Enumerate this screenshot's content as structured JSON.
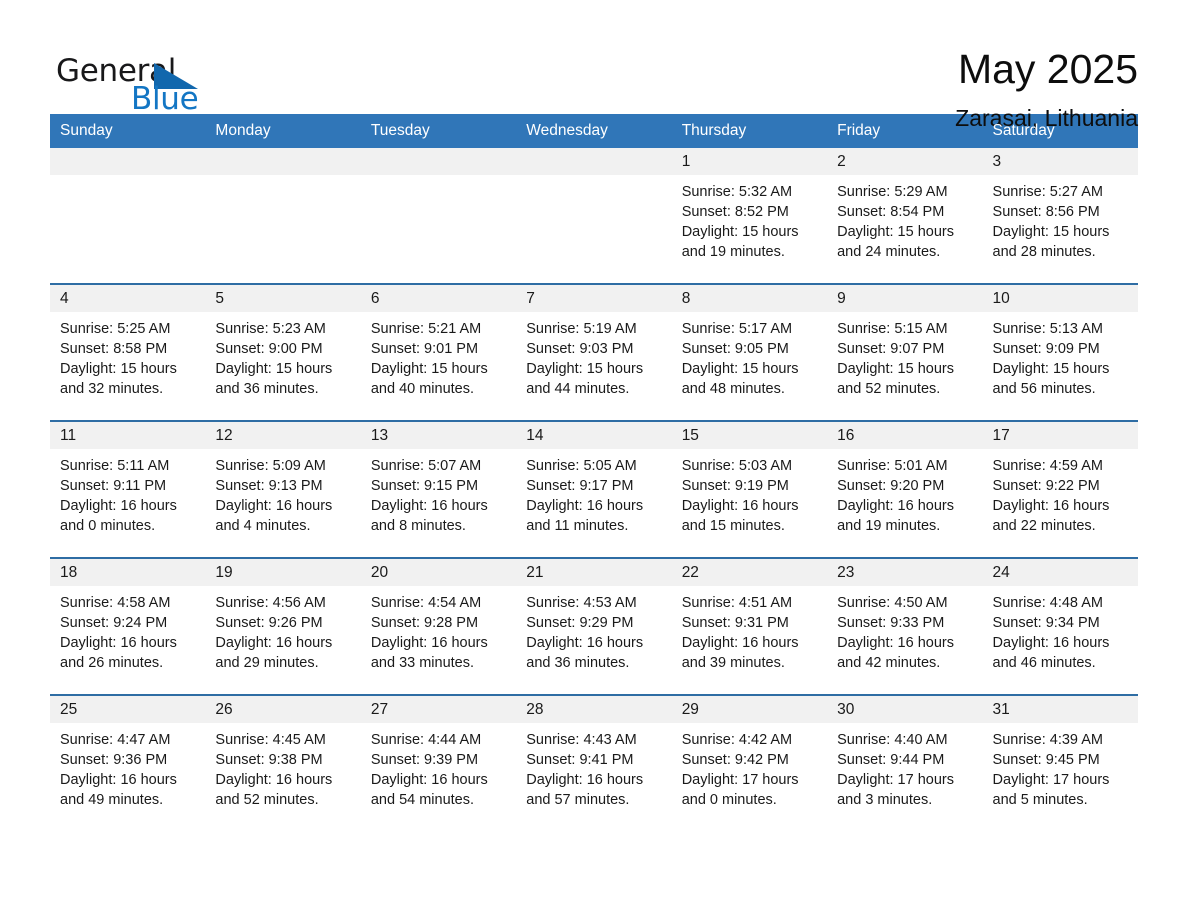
{
  "brand": {
    "word1": "General",
    "word2": "Blue",
    "triangle_color": "#1167ad",
    "blue_color": "#1376c4"
  },
  "header": {
    "title": "May 2025",
    "subtitle": "Zarasai, Lithuania"
  },
  "theme": {
    "header_blue": "#3076b8",
    "row_rule_blue": "#2e6da4",
    "daynum_band": "#f1f1f1"
  },
  "weekdays": [
    "Sunday",
    "Monday",
    "Tuesday",
    "Wednesday",
    "Thursday",
    "Friday",
    "Saturday"
  ],
  "weeks": [
    [
      {
        "blank": true
      },
      {
        "blank": true
      },
      {
        "blank": true
      },
      {
        "blank": true
      },
      {
        "day": "1",
        "sunrise": "Sunrise: 5:32 AM",
        "sunset": "Sunset: 8:52 PM",
        "daylight1": "Daylight: 15 hours",
        "daylight2": "and 19 minutes."
      },
      {
        "day": "2",
        "sunrise": "Sunrise: 5:29 AM",
        "sunset": "Sunset: 8:54 PM",
        "daylight1": "Daylight: 15 hours",
        "daylight2": "and 24 minutes."
      },
      {
        "day": "3",
        "sunrise": "Sunrise: 5:27 AM",
        "sunset": "Sunset: 8:56 PM",
        "daylight1": "Daylight: 15 hours",
        "daylight2": "and 28 minutes."
      }
    ],
    [
      {
        "day": "4",
        "sunrise": "Sunrise: 5:25 AM",
        "sunset": "Sunset: 8:58 PM",
        "daylight1": "Daylight: 15 hours",
        "daylight2": "and 32 minutes."
      },
      {
        "day": "5",
        "sunrise": "Sunrise: 5:23 AM",
        "sunset": "Sunset: 9:00 PM",
        "daylight1": "Daylight: 15 hours",
        "daylight2": "and 36 minutes."
      },
      {
        "day": "6",
        "sunrise": "Sunrise: 5:21 AM",
        "sunset": "Sunset: 9:01 PM",
        "daylight1": "Daylight: 15 hours",
        "daylight2": "and 40 minutes."
      },
      {
        "day": "7",
        "sunrise": "Sunrise: 5:19 AM",
        "sunset": "Sunset: 9:03 PM",
        "daylight1": "Daylight: 15 hours",
        "daylight2": "and 44 minutes."
      },
      {
        "day": "8",
        "sunrise": "Sunrise: 5:17 AM",
        "sunset": "Sunset: 9:05 PM",
        "daylight1": "Daylight: 15 hours",
        "daylight2": "and 48 minutes."
      },
      {
        "day": "9",
        "sunrise": "Sunrise: 5:15 AM",
        "sunset": "Sunset: 9:07 PM",
        "daylight1": "Daylight: 15 hours",
        "daylight2": "and 52 minutes."
      },
      {
        "day": "10",
        "sunrise": "Sunrise: 5:13 AM",
        "sunset": "Sunset: 9:09 PM",
        "daylight1": "Daylight: 15 hours",
        "daylight2": "and 56 minutes."
      }
    ],
    [
      {
        "day": "11",
        "sunrise": "Sunrise: 5:11 AM",
        "sunset": "Sunset: 9:11 PM",
        "daylight1": "Daylight: 16 hours",
        "daylight2": "and 0 minutes."
      },
      {
        "day": "12",
        "sunrise": "Sunrise: 5:09 AM",
        "sunset": "Sunset: 9:13 PM",
        "daylight1": "Daylight: 16 hours",
        "daylight2": "and 4 minutes."
      },
      {
        "day": "13",
        "sunrise": "Sunrise: 5:07 AM",
        "sunset": "Sunset: 9:15 PM",
        "daylight1": "Daylight: 16 hours",
        "daylight2": "and 8 minutes."
      },
      {
        "day": "14",
        "sunrise": "Sunrise: 5:05 AM",
        "sunset": "Sunset: 9:17 PM",
        "daylight1": "Daylight: 16 hours",
        "daylight2": "and 11 minutes."
      },
      {
        "day": "15",
        "sunrise": "Sunrise: 5:03 AM",
        "sunset": "Sunset: 9:19 PM",
        "daylight1": "Daylight: 16 hours",
        "daylight2": "and 15 minutes."
      },
      {
        "day": "16",
        "sunrise": "Sunrise: 5:01 AM",
        "sunset": "Sunset: 9:20 PM",
        "daylight1": "Daylight: 16 hours",
        "daylight2": "and 19 minutes."
      },
      {
        "day": "17",
        "sunrise": "Sunrise: 4:59 AM",
        "sunset": "Sunset: 9:22 PM",
        "daylight1": "Daylight: 16 hours",
        "daylight2": "and 22 minutes."
      }
    ],
    [
      {
        "day": "18",
        "sunrise": "Sunrise: 4:58 AM",
        "sunset": "Sunset: 9:24 PM",
        "daylight1": "Daylight: 16 hours",
        "daylight2": "and 26 minutes."
      },
      {
        "day": "19",
        "sunrise": "Sunrise: 4:56 AM",
        "sunset": "Sunset: 9:26 PM",
        "daylight1": "Daylight: 16 hours",
        "daylight2": "and 29 minutes."
      },
      {
        "day": "20",
        "sunrise": "Sunrise: 4:54 AM",
        "sunset": "Sunset: 9:28 PM",
        "daylight1": "Daylight: 16 hours",
        "daylight2": "and 33 minutes."
      },
      {
        "day": "21",
        "sunrise": "Sunrise: 4:53 AM",
        "sunset": "Sunset: 9:29 PM",
        "daylight1": "Daylight: 16 hours",
        "daylight2": "and 36 minutes."
      },
      {
        "day": "22",
        "sunrise": "Sunrise: 4:51 AM",
        "sunset": "Sunset: 9:31 PM",
        "daylight1": "Daylight: 16 hours",
        "daylight2": "and 39 minutes."
      },
      {
        "day": "23",
        "sunrise": "Sunrise: 4:50 AM",
        "sunset": "Sunset: 9:33 PM",
        "daylight1": "Daylight: 16 hours",
        "daylight2": "and 42 minutes."
      },
      {
        "day": "24",
        "sunrise": "Sunrise: 4:48 AM",
        "sunset": "Sunset: 9:34 PM",
        "daylight1": "Daylight: 16 hours",
        "daylight2": "and 46 minutes."
      }
    ],
    [
      {
        "day": "25",
        "sunrise": "Sunrise: 4:47 AM",
        "sunset": "Sunset: 9:36 PM",
        "daylight1": "Daylight: 16 hours",
        "daylight2": "and 49 minutes."
      },
      {
        "day": "26",
        "sunrise": "Sunrise: 4:45 AM",
        "sunset": "Sunset: 9:38 PM",
        "daylight1": "Daylight: 16 hours",
        "daylight2": "and 52 minutes."
      },
      {
        "day": "27",
        "sunrise": "Sunrise: 4:44 AM",
        "sunset": "Sunset: 9:39 PM",
        "daylight1": "Daylight: 16 hours",
        "daylight2": "and 54 minutes."
      },
      {
        "day": "28",
        "sunrise": "Sunrise: 4:43 AM",
        "sunset": "Sunset: 9:41 PM",
        "daylight1": "Daylight: 16 hours",
        "daylight2": "and 57 minutes."
      },
      {
        "day": "29",
        "sunrise": "Sunrise: 4:42 AM",
        "sunset": "Sunset: 9:42 PM",
        "daylight1": "Daylight: 17 hours",
        "daylight2": "and 0 minutes."
      },
      {
        "day": "30",
        "sunrise": "Sunrise: 4:40 AM",
        "sunset": "Sunset: 9:44 PM",
        "daylight1": "Daylight: 17 hours",
        "daylight2": "and 3 minutes."
      },
      {
        "day": "31",
        "sunrise": "Sunrise: 4:39 AM",
        "sunset": "Sunset: 9:45 PM",
        "daylight1": "Daylight: 17 hours",
        "daylight2": "and 5 minutes."
      }
    ]
  ]
}
